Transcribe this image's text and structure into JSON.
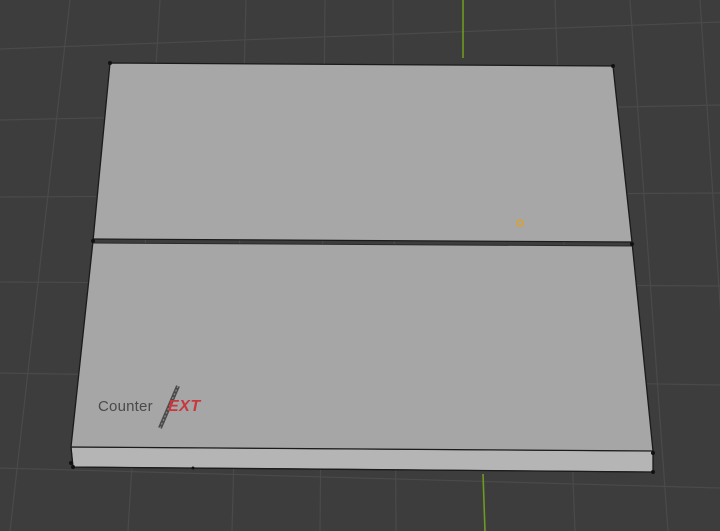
{
  "viewport": {
    "background_color": "#3d3d3d",
    "grid_line_color": "#4a4a4a",
    "y_axis_color": "#6e9a1f",
    "object_color": "#a9a9aa",
    "edge_color": "#1b1b1b",
    "origin_color": "#e0a020"
  },
  "logo": {
    "word": "Counter",
    "accent": "EXT",
    "accent_color": "#c9373d",
    "icon": "pen-icon"
  }
}
